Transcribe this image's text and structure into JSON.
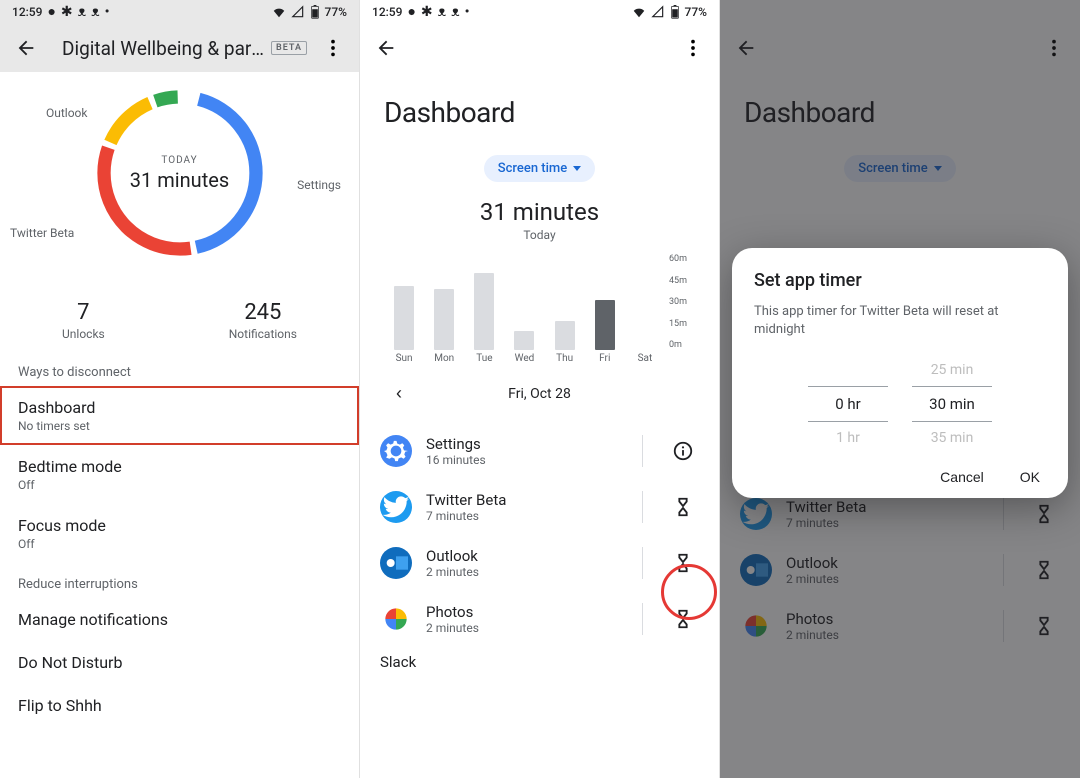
{
  "status": {
    "time": "12:59",
    "battery": "77%"
  },
  "p1": {
    "appbar_title": "Digital Wellbeing & pare...",
    "beta": "BETA",
    "donut": {
      "label": "TODAY",
      "value": "31 minutes",
      "annot_outlook": "Outlook",
      "annot_settings": "Settings",
      "annot_twitter": "Twitter Beta"
    },
    "stats": {
      "unlocks_num": "7",
      "unlocks_lbl": "Unlocks",
      "notif_num": "245",
      "notif_lbl": "Notifications"
    },
    "sec1": "Ways to disconnect",
    "rows1": [
      {
        "title": "Dashboard",
        "sub": "No timers set"
      },
      {
        "title": "Bedtime mode",
        "sub": "Off"
      },
      {
        "title": "Focus mode",
        "sub": "Off"
      }
    ],
    "sec2": "Reduce interruptions",
    "rows2": [
      {
        "title": "Manage notifications"
      },
      {
        "title": "Do Not Disturb"
      },
      {
        "title": "Flip to Shhh"
      }
    ]
  },
  "p2": {
    "title": "Dashboard",
    "chip": "Screen time",
    "metric_val": "31 minutes",
    "metric_sub": "Today",
    "date": "Fri, Oct 28",
    "apps": [
      {
        "name": "Settings",
        "sub": "16 minutes",
        "color": "#4285f4",
        "action": "info"
      },
      {
        "name": "Twitter Beta",
        "sub": "7 minutes",
        "color": "#1d9bf0",
        "action": "timer"
      },
      {
        "name": "Outlook",
        "sub": "2 minutes",
        "color": "#0f6cbd",
        "action": "timer"
      },
      {
        "name": "Photos",
        "sub": "2 minutes",
        "color": "#ffffff",
        "action": "timer"
      }
    ],
    "cutoff": "Slack"
  },
  "p3": {
    "dialog": {
      "title": "Set app timer",
      "desc": "This app timer for Twitter Beta will reset at midnight",
      "prev_min": "25 min",
      "hr": "0 hr",
      "min": "30 min",
      "next_hr": "1 hr",
      "next_min": "35 min",
      "cancel": "Cancel",
      "ok": "OK"
    }
  },
  "chart_data": {
    "type": "bar",
    "categories": [
      "Sun",
      "Mon",
      "Tue",
      "Wed",
      "Thu",
      "Fri",
      "Sat"
    ],
    "values": [
      40,
      38,
      48,
      12,
      18,
      31,
      0
    ],
    "active_index": 5,
    "ylim": [
      0,
      60
    ],
    "yticks": [
      "60m",
      "45m",
      "30m",
      "15m",
      "0m"
    ],
    "title": "Screen time",
    "xlabel": "",
    "ylabel": "minutes"
  }
}
